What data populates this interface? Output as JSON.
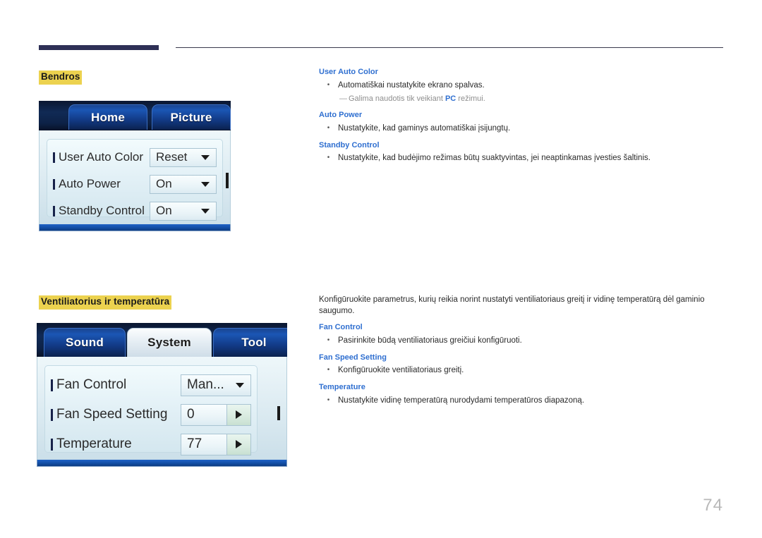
{
  "page": {
    "number": "74"
  },
  "sections": [
    {
      "heading": "Bendros",
      "osd": {
        "tabs": [
          {
            "label": "Home",
            "active": false
          },
          {
            "label": "Picture",
            "active": false
          }
        ],
        "rows": [
          {
            "label": "User Auto Color",
            "value": "Reset",
            "control": "dropdown"
          },
          {
            "label": "Auto Power",
            "value": "On",
            "control": "dropdown"
          },
          {
            "label": "Standby Control",
            "value": "On",
            "control": "dropdown"
          }
        ]
      },
      "text": {
        "intro": "",
        "items": [
          {
            "keyword": "User Auto Color",
            "bullets": [
              "Automatiškai nustatykite ekrano spalvas."
            ],
            "note": {
              "prefix": "Galima naudotis tik veikiant ",
              "bold": "PC",
              "suffix": " režimui."
            }
          },
          {
            "keyword": "Auto Power",
            "bullets": [
              "Nustatykite, kad gaminys automatiškai įsijungtų."
            ],
            "note": null
          },
          {
            "keyword": "Standby Control",
            "bullets": [
              "Nustatykite, kad budėjimo režimas būtų suaktyvintas, jei neaptinkamas įvesties šaltinis."
            ],
            "note": null
          }
        ]
      }
    },
    {
      "heading": "Ventiliatorius ir temperatūra",
      "osd": {
        "tabs": [
          {
            "label": "Sound",
            "active": false
          },
          {
            "label": "System",
            "active": true
          },
          {
            "label": "Tool",
            "active": false
          }
        ],
        "rows": [
          {
            "label": "Fan Control",
            "value": "Man...",
            "control": "dropdown"
          },
          {
            "label": "Fan Speed Setting",
            "value": "0",
            "control": "stepper"
          },
          {
            "label": "Temperature",
            "value": "77",
            "control": "stepper"
          }
        ]
      },
      "text": {
        "intro": "Konfigūruokite parametrus, kurių reikia norint nustatyti ventiliatoriaus greitį ir vidinę temperatūrą dėl gaminio saugumo.",
        "items": [
          {
            "keyword": "Fan Control",
            "bullets": [
              "Pasirinkite būdą ventiliatoriaus greičiui konfigūruoti."
            ],
            "note": null
          },
          {
            "keyword": "Fan Speed Setting",
            "bullets": [
              "Konfigūruokite ventiliatoriaus greitį."
            ],
            "note": null
          },
          {
            "keyword": "Temperature",
            "bullets": [
              "Nustatykite vidinę temperatūrą nurodydami temperatūros diapazoną."
            ],
            "note": null
          }
        ]
      }
    }
  ],
  "colors": {
    "highlight": "#ecd24f",
    "keyword_blue": "#2f6fd0",
    "header_bar": "#2e3056",
    "page_number": "#b8b8b8"
  },
  "bullet_glyph": "•",
  "note_dash": "—"
}
